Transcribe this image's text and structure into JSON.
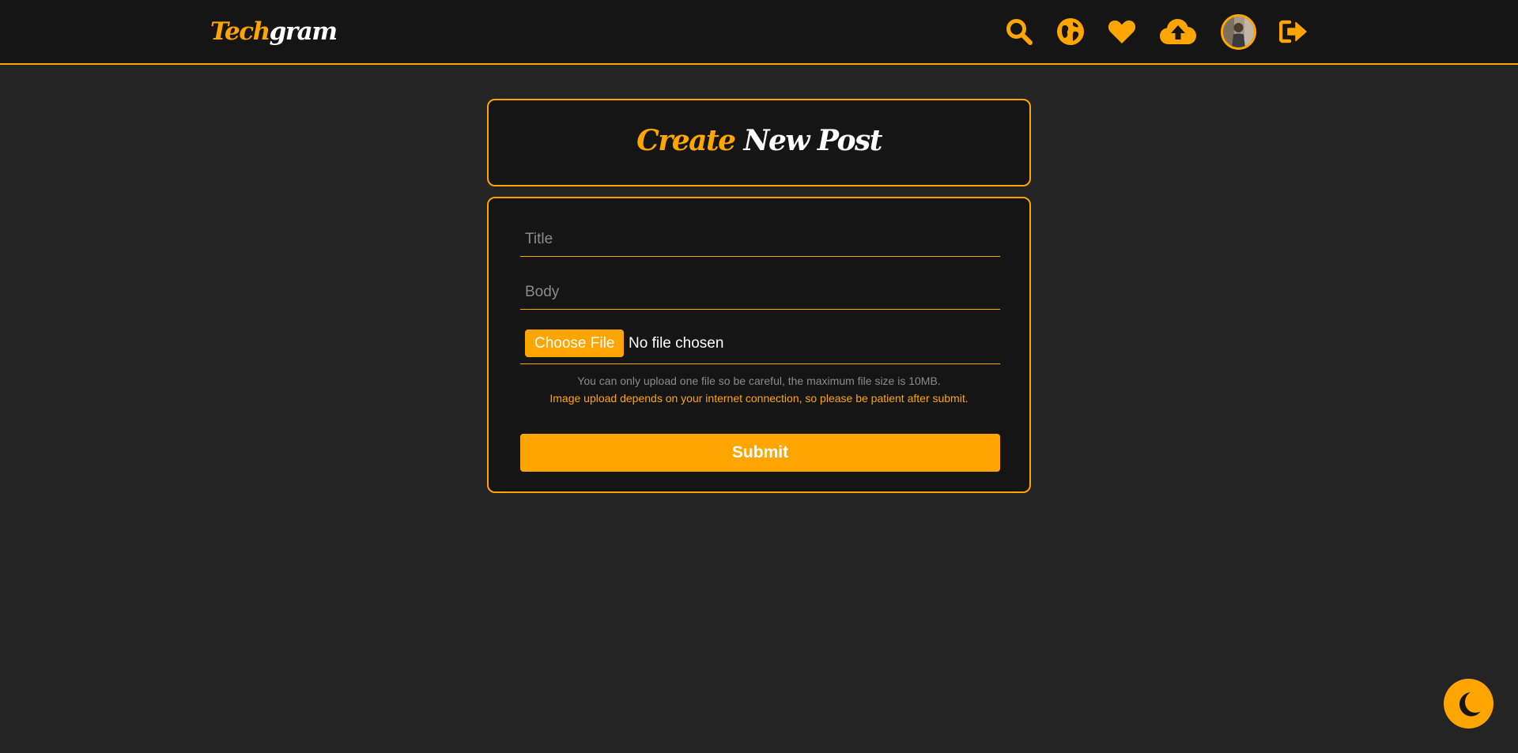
{
  "app": {
    "logo_part1": "Tech",
    "logo_part2": "gram"
  },
  "nav": {
    "icons": [
      "search-icon",
      "globe-icon",
      "heart-icon",
      "cloud-upload-icon",
      "avatar",
      "logout-icon"
    ]
  },
  "page": {
    "title_part1": "Create",
    "title_part2": "New Post"
  },
  "form": {
    "title_placeholder": "Title",
    "body_placeholder": "Body",
    "title_value": "",
    "body_value": "",
    "file_button_label": "Choose File",
    "file_status": "No file chosen",
    "note_limit": "You can only upload one file so be careful, the maximum file size is 10MB.",
    "note_patience": "Image upload depends on your internet connection, so please be patient after submit.",
    "submit_label": "Submit"
  },
  "theme": {
    "icon": "moon-icon",
    "accent_color": "#ffa500",
    "background_color": "#242424",
    "surface_color": "#151515"
  }
}
